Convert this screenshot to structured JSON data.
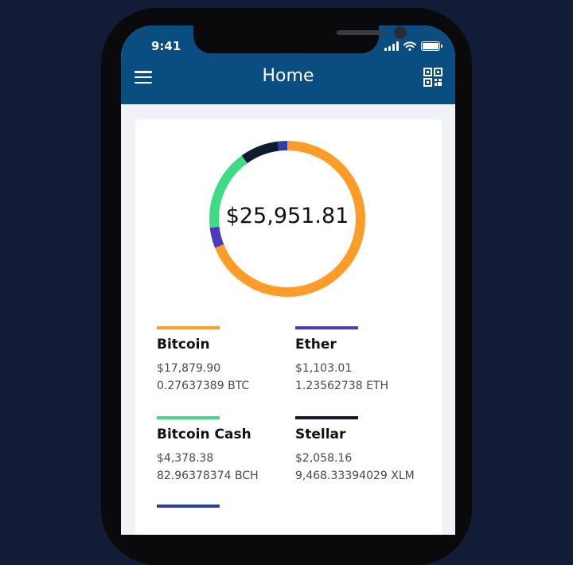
{
  "status_bar": {
    "time": "9:41"
  },
  "app_bar": {
    "title": "Home",
    "menu_icon": "hamburger-menu-icon",
    "right_icon": "qr-code-icon"
  },
  "portfolio": {
    "total": "$25,951.81",
    "colors": {
      "bitcoin": "#ff9c28",
      "ether": "#4b3bc2",
      "bitcoin_cash": "#3ddc84",
      "stellar": "#111a30",
      "next": "#2a3fa8"
    },
    "allocation": [
      {
        "key": "bitcoin",
        "value": 17879.9
      },
      {
        "key": "ether",
        "value": 1103.01
      },
      {
        "key": "bitcoin_cash",
        "value": 4378.38
      },
      {
        "key": "stellar",
        "value": 2058.16
      },
      {
        "key": "next",
        "value": 532.36
      }
    ]
  },
  "coins": {
    "bitcoin": {
      "name": "Bitcoin",
      "usd": "$17,879.90",
      "amount": "0.27637389 BTC"
    },
    "ether": {
      "name": "Ether",
      "usd": "$1,103.01",
      "amount": "1.23562738 ETH"
    },
    "bitcoin_cash": {
      "name": "Bitcoin Cash",
      "usd": "$4,378.38",
      "amount": "82.96378374 BCH"
    },
    "stellar": {
      "name": "Stellar",
      "usd": "$2,058.16",
      "amount": "9,468.33394029 XLM"
    }
  }
}
